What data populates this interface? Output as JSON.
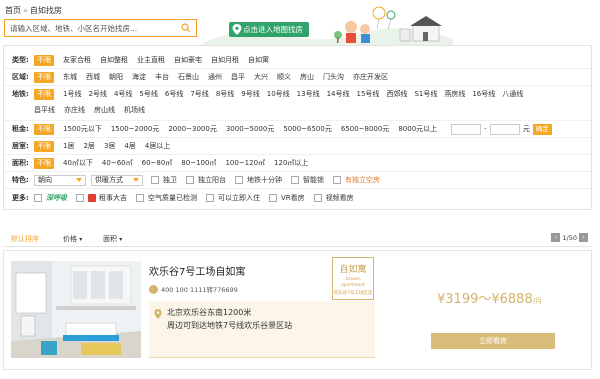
{
  "breadcrumb": {
    "home": "首页",
    "separator": "»",
    "current": "自如找房"
  },
  "search": {
    "placeholder": "请输入区域、地铁、小区名开始找房..."
  },
  "banner": {
    "map_button": "点击进入地图找房"
  },
  "filters": {
    "type": {
      "label": "类型:",
      "unlimited": "不限",
      "options": [
        "友家合租",
        "自如整租",
        "业主直租",
        "自如豪宅",
        "自如月租",
        "自如寓"
      ]
    },
    "district": {
      "label": "区域:",
      "unlimited": "不限",
      "options": [
        "东城",
        "西城",
        "朝阳",
        "海淀",
        "丰台",
        "石景山",
        "通州",
        "昌平",
        "大兴",
        "顺义",
        "房山",
        "门头沟",
        "亦庄开发区"
      ]
    },
    "subway": {
      "label": "地铁:",
      "unlimited": "不限",
      "options_row1": [
        "1号线",
        "2号线",
        "4号线",
        "5号线",
        "6号线",
        "7号线",
        "8号线",
        "9号线",
        "10号线",
        "13号线",
        "14号线",
        "15号线",
        "西郊线",
        "S1号线",
        "燕房线",
        "16号线",
        "八通线"
      ],
      "options_row2": [
        "昌平线",
        "亦庄线",
        "房山线",
        "机场线"
      ]
    },
    "rent": {
      "label": "租金:",
      "unlimited": "不限",
      "options": [
        "1500元以下",
        "1500~2000元",
        "2000~3000元",
        "3000~5000元",
        "5000~6500元",
        "6500~8000元",
        "8000元以上"
      ],
      "dash": "-",
      "unit": "元",
      "confirm": "确定"
    },
    "rooms": {
      "label": "居室:",
      "unlimited": "不限",
      "options": [
        "1居",
        "2居",
        "3居",
        "4居",
        "4居以上"
      ]
    },
    "area": {
      "label": "面积:",
      "unlimited": "不限",
      "options": [
        "40㎡以下",
        "40~60㎡",
        "60~80㎡",
        "80~100㎡",
        "100~120㎡",
        "120㎡以上"
      ]
    },
    "features": {
      "label": "特色:",
      "orientation": "朝向",
      "heating": "供暖方式",
      "checks": [
        "独卫",
        "独立阳台",
        "地铁十分钟",
        "智能锁",
        "有独立空房"
      ]
    },
    "more": {
      "label": "更多:",
      "logo_text": "深呼吸",
      "checks": [
        "租事大吉",
        "空气质量已检测",
        "可以立即入住",
        "VR看房",
        "视频看房"
      ]
    }
  },
  "sort": {
    "default": "默认排序",
    "price": "价格",
    "area": "面积",
    "page": "1/50",
    "prev": "‹",
    "next": "›"
  },
  "listing": {
    "title": "欢乐谷7号工场自如寓",
    "phone": "400 100 1111转776699",
    "logo_cn": "自如寓",
    "logo_en": "ziroom apartment",
    "logo_sub": "欢乐谷7号工场区店",
    "address1": "北京欢乐谷东南1200米",
    "address2": "周边可到达地铁7号线欢乐谷景区站",
    "price": "¥3199～¥6888",
    "price_unit": "/月",
    "view_button": "立即看房"
  },
  "colors": {
    "accent": "#f5a623",
    "gold": "#d4b46c",
    "green": "#2fa369"
  }
}
